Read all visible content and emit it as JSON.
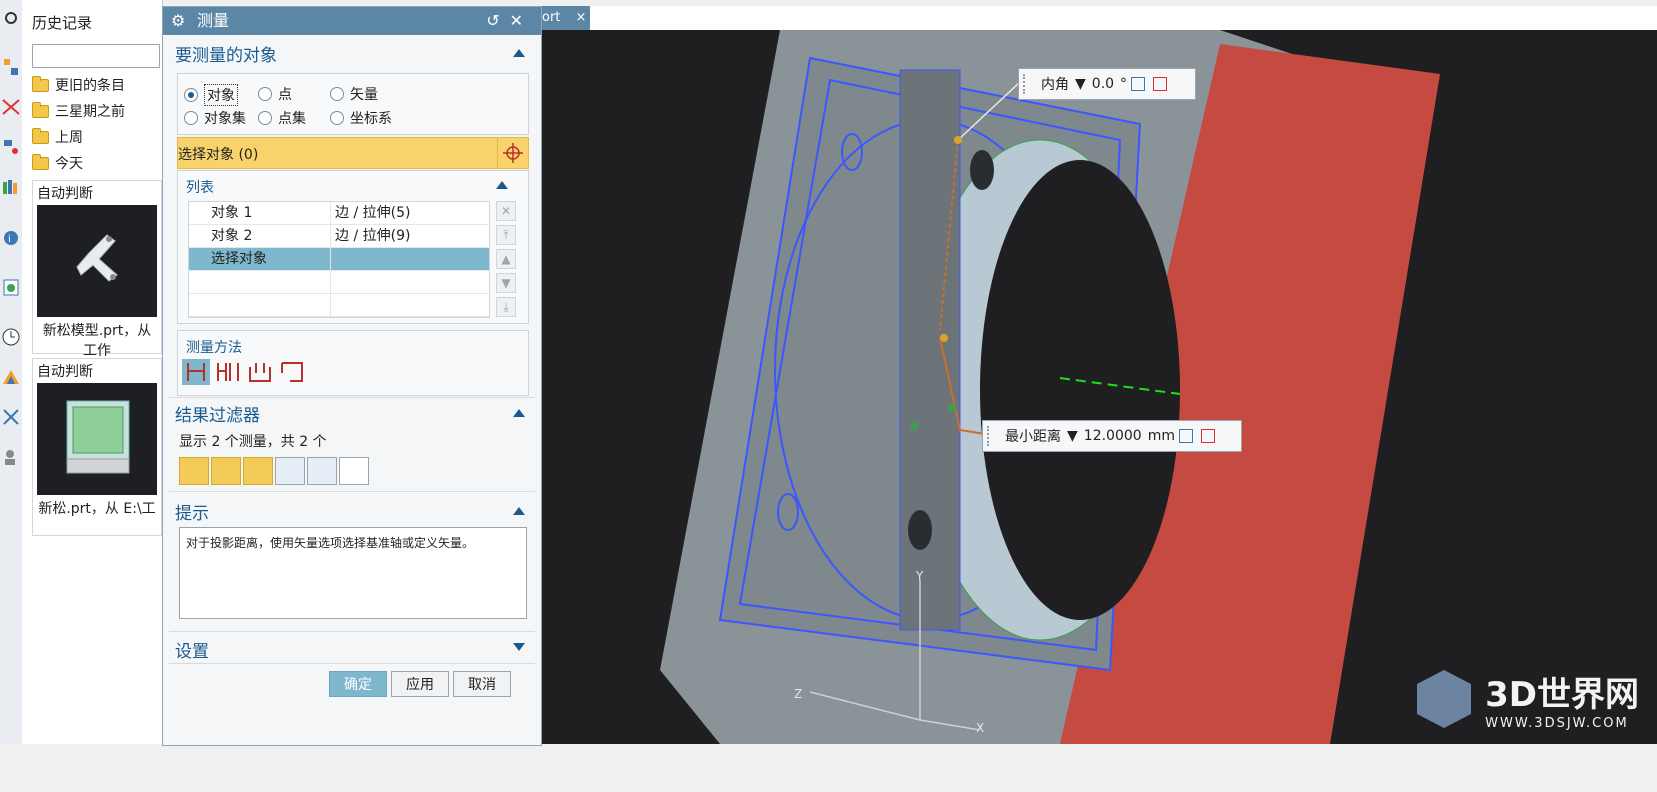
{
  "history": {
    "title": "历史记录",
    "folders": [
      {
        "label": "更旧的条目"
      },
      {
        "label": "三星期之前"
      },
      {
        "label": "上周"
      },
      {
        "label": "今天"
      }
    ],
    "cards": [
      {
        "header": "自动判断",
        "caption": "新松模型.prt，从\n工作"
      },
      {
        "header": "自动判断",
        "caption": "新松.prt，从 E:\\工"
      }
    ]
  },
  "dialog": {
    "title": "测量",
    "section_target": {
      "title": "要测量的对象",
      "radios": [
        {
          "label": "对象",
          "checked": true
        },
        {
          "label": "点",
          "checked": false
        },
        {
          "label": "矢量",
          "checked": false
        },
        {
          "label": "对象集",
          "checked": false
        },
        {
          "label": "点集",
          "checked": false
        },
        {
          "label": "坐标系",
          "checked": false
        }
      ],
      "select_label": "选择对象 (0)",
      "list_title": "列表",
      "list_rows": [
        {
          "name": "对象 1",
          "value": "边 / 拉伸(5)"
        },
        {
          "name": "对象 2",
          "value": "边 / 拉伸(9)"
        },
        {
          "name": "选择对象",
          "value": ""
        }
      ],
      "method_title": "测量方法"
    },
    "section_filter": {
      "title": "结果过滤器",
      "summary": "显示 2 个测量，共 2 个"
    },
    "section_hint": {
      "title": "提示",
      "text": "对于投影距离，使用矢量选项选择基准轴或定义矢量。"
    },
    "section_settings": {
      "title": "设置"
    },
    "buttons": {
      "ok": "确定",
      "apply": "应用",
      "cancel": "取消"
    }
  },
  "tabstrip": {
    "tab_label": "ort",
    "tab_close": "×"
  },
  "viewport": {
    "angle_popup": {
      "type": "内角",
      "value": "0.0",
      "unit": "°"
    },
    "distance_popup": {
      "type": "最小距离",
      "value": "12.0000",
      "unit": "mm"
    },
    "axes": {
      "x": "X",
      "y": "Y",
      "z": "Z"
    },
    "watermark": {
      "brand": "3D世界网",
      "url": "WWW.3DSJW.COM"
    }
  },
  "colors": {
    "dialog_title_bg": "#5c86a6",
    "selection_highlight": "#f8d36c",
    "list_selection": "#7fb7cd",
    "edge_blue": "#3b57ff",
    "red_face": "#c54b42",
    "viewport_bg": "#1f1f21"
  }
}
